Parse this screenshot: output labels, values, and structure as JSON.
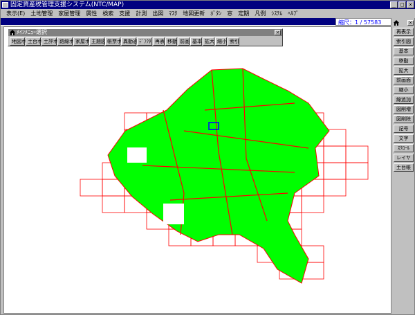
{
  "window": {
    "title": "固定資産税管理支援システム(NTC/MAP)",
    "controls": {
      "minimize": "_",
      "maximize": "□",
      "close": "×"
    }
  },
  "menu": [
    "表示(E)",
    "土地管理",
    "家屋管理",
    "属性",
    "検索",
    "支援",
    "計測",
    "出図",
    "ﾏｽﾀ",
    "地図更新",
    "ﾎﾞﾀﾝ",
    "窓",
    "定期",
    "凡例",
    "ｼｽﾃﾑ",
    "ﾍﾙﾌﾟ"
  ],
  "scale": {
    "text": "縮尺：1 / 57583"
  },
  "submenu": {
    "title": "ﾒｲﾝﾒﾆｭｰ選択",
    "close": "×",
    "buttons": [
      "地図ボ",
      "土台ボ",
      "土評ボ",
      "路線ボ",
      "家屋ボ",
      "主題図",
      "帳票ボ",
      "異動通",
      "ﾃﾞﾌｸﾀ",
      "再表",
      "移動",
      "前画",
      "基本",
      "拡大",
      "縮小",
      "索引"
    ]
  },
  "right_panel": {
    "close": "×",
    "buttons": [
      "再表示",
      "索引図",
      "基本",
      "移動",
      "拡大",
      "前画面",
      "縮小",
      "線追加",
      "図削増",
      "図削除",
      "記号",
      "文字",
      "ｽｸﾛｰﾙ",
      "レイヤ",
      "土台帳"
    ]
  },
  "map": {
    "parcel_color": "#00ff00",
    "grid_color": "#ff0000",
    "highlight_color": "#0000ff"
  }
}
